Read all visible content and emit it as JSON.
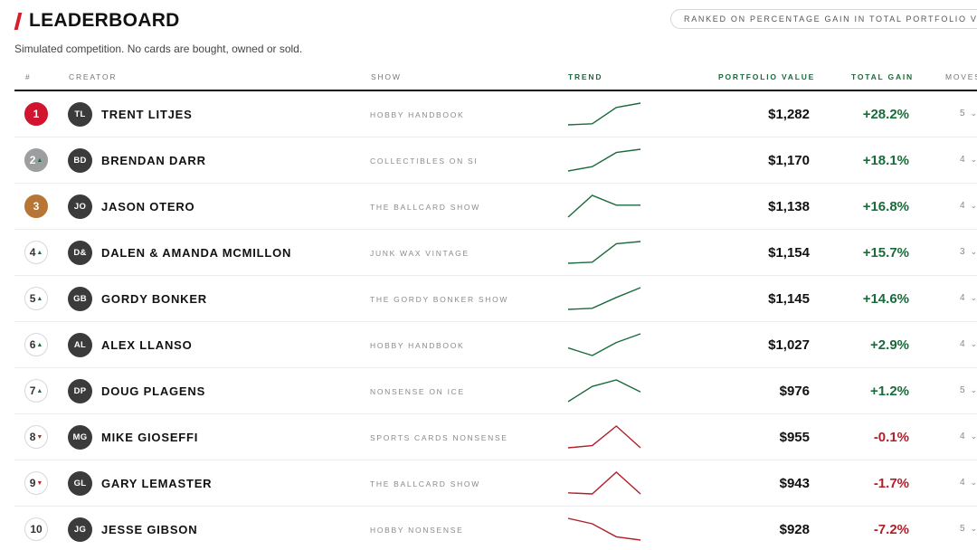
{
  "header": {
    "title": "LEADERBOARD",
    "rank_note": "RANKED ON PERCENTAGE GAIN IN TOTAL PORTFOLIO VALUE",
    "subtitle": "Simulated competition. No cards are bought, owned or sold."
  },
  "columns": {
    "rank": "#",
    "creator": "CREATOR",
    "show": "SHOW",
    "trend": "TREND",
    "portfolio_value": "PORTFOLIO VALUE",
    "total_gain": "TOTAL GAIN",
    "moves": "MOVES"
  },
  "colors": {
    "accent_red": "#d61f2c",
    "positive_green": "#1a6b3c",
    "negative_red": "#b0202a",
    "gold": "#d1152e",
    "silver": "#9d9ea0",
    "bronze": "#b87636"
  },
  "rows": [
    {
      "rank": "1",
      "move": "",
      "initials": "TL",
      "name": "TRENT LITJES",
      "show": "HOBBY HANDBOOK",
      "value": "$1,282",
      "gain": "+28.2%",
      "moves": "5",
      "trend": [
        0,
        0.05,
        0.8,
        1
      ],
      "trend_dir": "up"
    },
    {
      "rank": "2",
      "move": "up",
      "initials": "BD",
      "name": "BRENDAN DARR",
      "show": "COLLECTIBLES ON SI",
      "value": "$1,170",
      "gain": "+18.1%",
      "moves": "4",
      "trend": [
        0,
        0.2,
        0.85,
        1
      ],
      "trend_dir": "up"
    },
    {
      "rank": "3",
      "move": "",
      "initials": "JO",
      "name": "JASON OTERO",
      "show": "THE BALLCARD SHOW",
      "value": "$1,138",
      "gain": "+16.8%",
      "moves": "4",
      "trend": [
        0,
        1,
        0.55,
        0.55
      ],
      "trend_dir": "up"
    },
    {
      "rank": "4",
      "move": "up",
      "initials": "D&",
      "name": "DALEN & AMANDA MCMILLON",
      "show": "JUNK WAX VINTAGE",
      "value": "$1,154",
      "gain": "+15.7%",
      "moves": "3",
      "trend": [
        0,
        0.05,
        0.9,
        1
      ],
      "trend_dir": "up"
    },
    {
      "rank": "5",
      "move": "up",
      "initials": "GB",
      "name": "GORDY BONKER",
      "show": "THE GORDY BONKER SHOW",
      "value": "$1,145",
      "gain": "+14.6%",
      "moves": "4",
      "trend": [
        0,
        0.05,
        0.55,
        1
      ],
      "trend_dir": "up"
    },
    {
      "rank": "6",
      "move": "up",
      "initials": "AL",
      "name": "ALEX LLANSO",
      "show": "HOBBY HANDBOOK",
      "value": "$1,027",
      "gain": "+2.9%",
      "moves": "4",
      "trend": [
        0.35,
        0,
        0.6,
        1
      ],
      "trend_dir": "up"
    },
    {
      "rank": "7",
      "move": "up",
      "initials": "DP",
      "name": "DOUG PLAGENS",
      "show": "NONSENSE ON ICE",
      "value": "$976",
      "gain": "+1.2%",
      "moves": "5",
      "trend": [
        0,
        0.7,
        1,
        0.45
      ],
      "trend_dir": "up"
    },
    {
      "rank": "8",
      "move": "down",
      "initials": "MG",
      "name": "MIKE GIOSEFFI",
      "show": "SPORTS CARDS NONSENSE",
      "value": "$955",
      "gain": "-0.1%",
      "moves": "4",
      "trend": [
        0,
        0.1,
        1,
        0
      ],
      "trend_dir": "down"
    },
    {
      "rank": "9",
      "move": "down",
      "initials": "GL",
      "name": "GARY LEMASTER",
      "show": "THE BALLCARD SHOW",
      "value": "$943",
      "gain": "-1.7%",
      "moves": "4",
      "trend": [
        0.05,
        0,
        1,
        0
      ],
      "trend_dir": "down"
    },
    {
      "rank": "10",
      "move": "",
      "initials": "JG",
      "name": "JESSE GIBSON",
      "show": "HOBBY NONSENSE",
      "value": "$928",
      "gain": "-7.2%",
      "moves": "5",
      "trend": [
        1,
        0.75,
        0.15,
        0
      ],
      "trend_dir": "down"
    }
  ]
}
